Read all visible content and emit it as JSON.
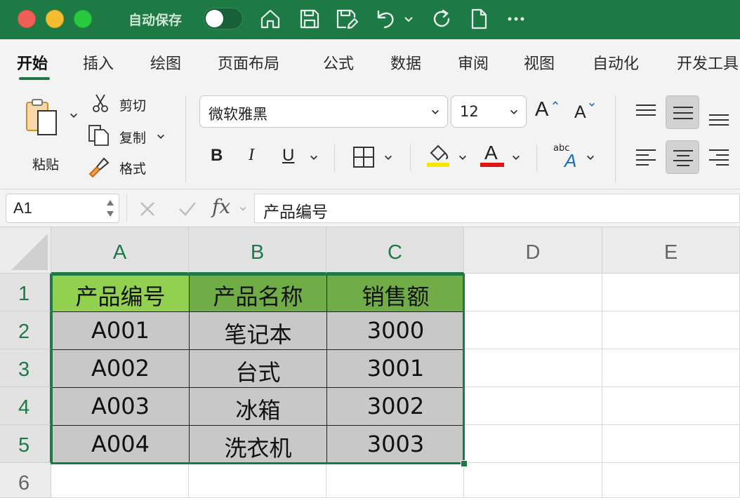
{
  "titlebar": {
    "autosave_label": "自动保存",
    "icons": [
      "home-icon",
      "save-icon",
      "save-as-icon",
      "undo-icon",
      "redo-icon",
      "new-document-icon",
      "more-icon"
    ]
  },
  "ribbon_tabs": [
    "开始",
    "插入",
    "绘图",
    "页面布局",
    "公式",
    "数据",
    "审阅",
    "视图",
    "自动化",
    "开发工具"
  ],
  "clipboard": {
    "paste": "粘贴",
    "cut": "剪切",
    "copy": "复制",
    "format": "格式"
  },
  "font": {
    "name": "微软雅黑",
    "size": "12",
    "bold": "B",
    "italic": "I",
    "underline": "U",
    "font_color_letter": "A",
    "highlight_color": "#f7e600",
    "font_color": "#e21313",
    "abc": "abc",
    "grow_letter": "A",
    "shrink_letter": "A"
  },
  "formula_bar": {
    "cell_ref": "A1",
    "fx": "fx",
    "content": "产品编号"
  },
  "columns": [
    "A",
    "B",
    "C",
    "D",
    "E"
  ],
  "rows": [
    "1",
    "2",
    "3",
    "4",
    "5",
    "6"
  ],
  "table": {
    "header_colors": [
      "#92d050",
      "#70ad47",
      "#70ad47"
    ],
    "body_color": "#c8c8c8",
    "headers": [
      "产品编号",
      "产品名称",
      "销售额"
    ],
    "rows": [
      [
        "A001",
        "笔记本",
        "3000"
      ],
      [
        "A002",
        "台式",
        "3001"
      ],
      [
        "A003",
        "冰箱",
        "3002"
      ],
      [
        "A004",
        "洗衣机",
        "3003"
      ]
    ]
  }
}
